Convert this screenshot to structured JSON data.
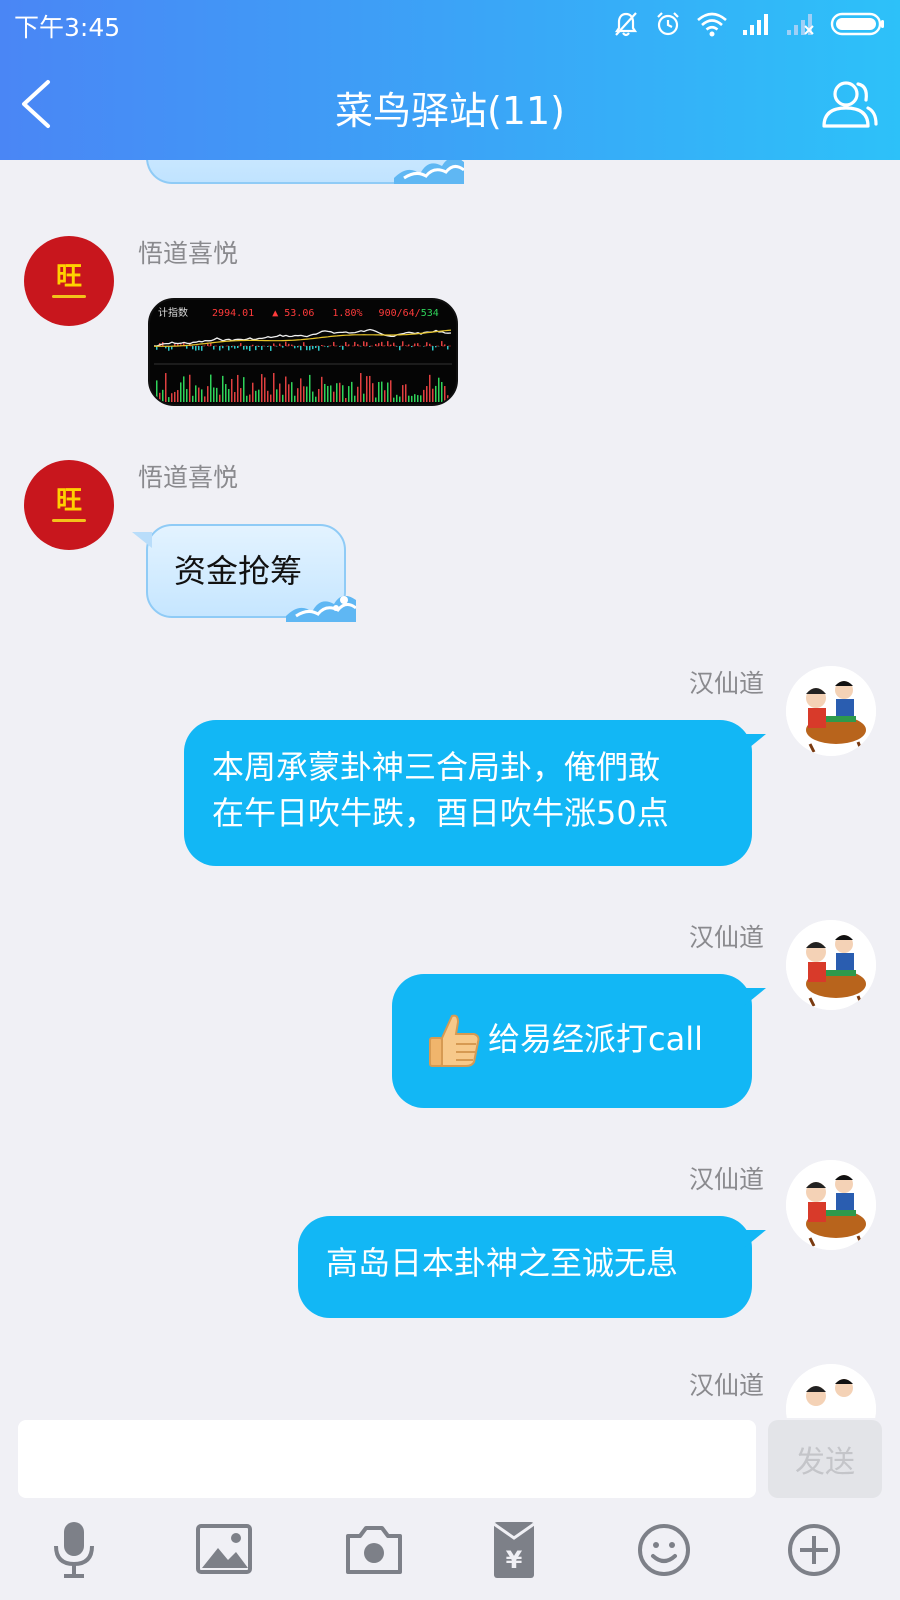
{
  "status_bar": {
    "time": "下午3:45"
  },
  "header": {
    "title": "菜鸟驿站(11)"
  },
  "messages": [
    {
      "side": "left",
      "sender": "悟道喜悦",
      "type": "image",
      "image": {
        "label": "计指数",
        "price": "2994.01",
        "change": "▲ 53.06",
        "percent": "1.80%",
        "counts_a": "900/64/",
        "counts_b": "534"
      }
    },
    {
      "side": "left",
      "sender": "悟道喜悦",
      "type": "text",
      "text": "资金抢筹"
    },
    {
      "side": "right",
      "sender": "汉仙道",
      "type": "text",
      "lines": [
        "本周承蒙卦神三合局卦，俺們敢",
        "在午日吹牛跌，酉日吹牛涨50点"
      ]
    },
    {
      "side": "right",
      "sender": "汉仙道",
      "type": "text",
      "text": "给易经派打call"
    },
    {
      "side": "right",
      "sender": "汉仙道",
      "type": "text",
      "text": "高岛日本卦神之至诚无息"
    },
    {
      "side": "right",
      "sender": "汉仙道",
      "type": "partial"
    }
  ],
  "avatar_left": {
    "glyph": "旺"
  },
  "input": {
    "value": "",
    "send_label": "发送"
  },
  "icons": {
    "back": "chevron-left-icon",
    "members": "group-icon",
    "toolbar": [
      "microphone-icon",
      "image-icon",
      "camera-icon",
      "red-packet-icon",
      "emoji-icon",
      "plus-circle-icon"
    ]
  },
  "colors": {
    "header_start": "#4a86f5",
    "header_end": "#2dc1f9",
    "bubble_right": "#12b7f5",
    "bubble_left": "#c6e6ff",
    "background": "#f0f0f5"
  }
}
